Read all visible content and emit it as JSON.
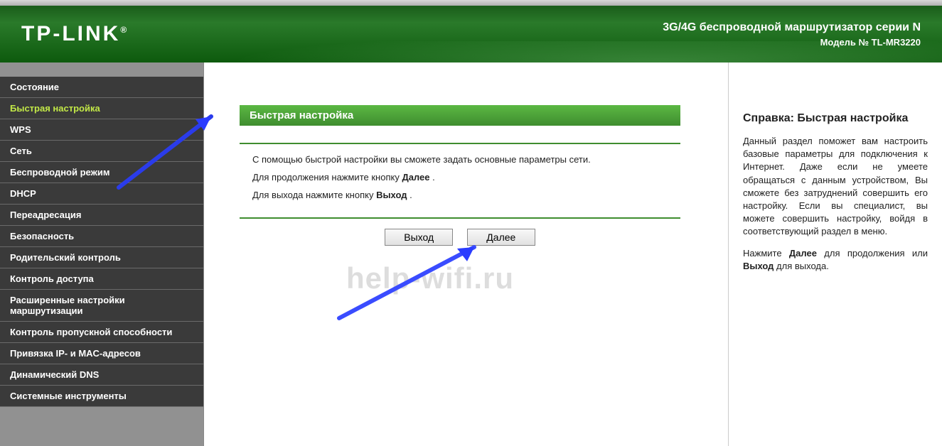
{
  "header": {
    "logo": "TP-LINK",
    "title": "3G/4G беспроводной маршрутизатор серии N",
    "model": "Модель № TL-MR3220"
  },
  "sidebar": {
    "items": [
      "Состояние",
      "Быстрая настройка",
      "WPS",
      "Сеть",
      "Беспроводной режим",
      "DHCP",
      "Переадресация",
      "Безопасность",
      "Родительский контроль",
      "Контроль доступа",
      "Расширенные настройки маршрутизации",
      "Контроль пропускной способности",
      "Привязка IP- и MAC-адресов",
      "Динамический DNS",
      "Системные инструменты"
    ],
    "activeIndex": 1
  },
  "main": {
    "title": "Быстрая настройка",
    "line1": "С помощью быстрой настройки вы сможете задать основные параметры сети.",
    "line2_pre": "Для продолжения нажмите кнопку ",
    "line2_bold": "Далее",
    "line2_post": " .",
    "line3_pre": "Для выхода нажмите кнопку ",
    "line3_bold": "Выход",
    "line3_post": " .",
    "btn_exit": "Выход",
    "btn_next": "Далее",
    "watermark": "help-wifi.ru"
  },
  "help": {
    "title": "Справка: Быстрая настройка",
    "p1": "Данный раздел поможет вам настроить базовые параметры для подключения к Интернет. Даже если не умеете обращаться с данным устройством, Вы сможете без затруднений совершить его настройку. Если вы специалист, вы можете совершить настройку, войдя в соответствующий раздел в меню.",
    "p2_pre": "Нажмите ",
    "p2_b1": "Далее",
    "p2_mid": " для продолжения или ",
    "p2_b2": "Выход",
    "p2_post": " для выхода."
  }
}
